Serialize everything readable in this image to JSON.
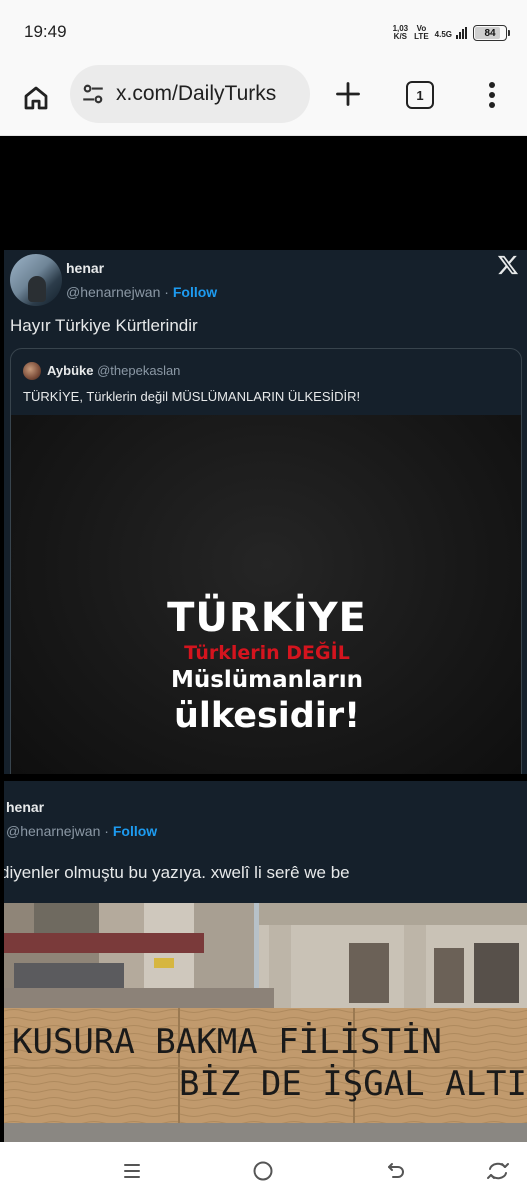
{
  "status_bar": {
    "time": "19:49",
    "net_speed_value": "1,03",
    "net_speed_unit": "K/S",
    "volte_top": "Vo",
    "volte_bottom": "LTE",
    "signal_label": "4.5G",
    "battery": "84",
    "battery_level": 0.84
  },
  "browser": {
    "url": "x.com/DailyTurks",
    "tab_count": "1"
  },
  "post1": {
    "author_name": "henar",
    "author_handle": "@henarnejwan",
    "separator": "·",
    "follow_label": "Follow",
    "text": "Hayır Türkiye Kürtlerindir",
    "quote": {
      "author_name": "Aybüke",
      "author_handle": "@thepekaslan",
      "text": "TÜRKİYE, Türklerin değil MÜSLÜMANLARIN ÜLKESİDİR!",
      "image_lines": [
        "TÜRKİYE",
        "Türklerin DEĞİL",
        "Müslümanların",
        "ülkesidir!"
      ]
    }
  },
  "post2": {
    "author_name": "henar",
    "author_handle": "@henarnejwan",
    "separator": "·",
    "follow_label": "Follow",
    "text": "diyenler olmuştu bu yazıya. xwelî li serê we be",
    "image_lines": [
      "KUSURA BAKMA FİLİSTİN",
      "BİZ DE İŞGAL ALTINDA"
    ]
  },
  "colors": {
    "tweet_bg": "#15202b",
    "accent": "#1d9bf0",
    "secondary_text": "#8b98a5",
    "poster_red": "#d4141e"
  },
  "icons": {
    "home": "home-icon",
    "site_settings": "tune-icon",
    "new_tab": "plus-icon",
    "menu": "more-vert-icon",
    "x_logo": "x-logo-icon",
    "nav_recents": "recents-icon",
    "nav_home": "home-circle-icon",
    "nav_back": "back-icon",
    "nav_rotate": "rotate-icon"
  }
}
